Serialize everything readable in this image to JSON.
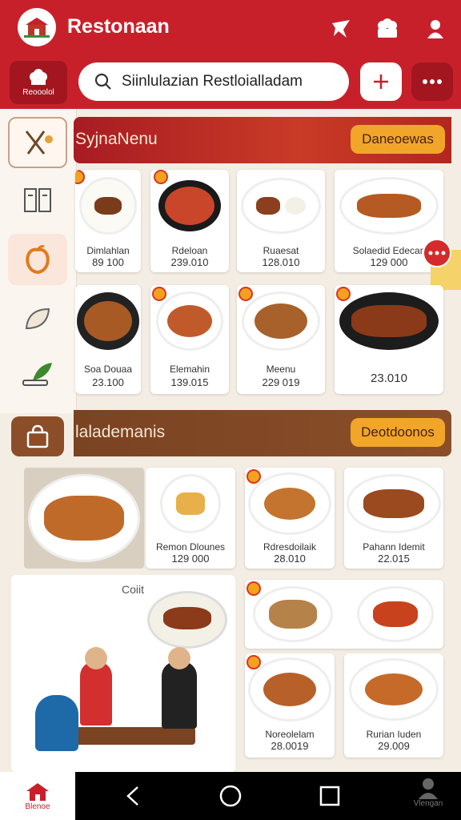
{
  "app": {
    "title": "Restonaan",
    "logo_icon": "restaurant-logo-icon"
  },
  "header": {
    "icons": [
      "pin-icon",
      "chef-hat-icon",
      "person-icon"
    ]
  },
  "searchbar": {
    "home_label": "Reooolol",
    "query": "Siinlulazian Restloialladam",
    "add_icon": "plus-icon",
    "more_icon": "more-dots-icon"
  },
  "sidebar": {
    "items": [
      {
        "icon": "utensils-icon",
        "selected": true
      },
      {
        "icon": "menu-card-icon",
        "selected": false
      },
      {
        "icon": "fruit-icon",
        "selected": true
      },
      {
        "icon": "leaf-icon",
        "selected": false
      },
      {
        "icon": "herb-icon",
        "selected": false
      }
    ]
  },
  "section1": {
    "title": "SyjnaNenu",
    "button": "Daneoewas",
    "items": [
      {
        "name": "Dimlahlan",
        "price": "89 100"
      },
      {
        "name": "Rdeloan",
        "price": "239.010"
      },
      {
        "name": "Ruaesat",
        "price": "128.010"
      },
      {
        "name": "Solaedid Edecan",
        "price": "129 000"
      },
      {
        "name": "Soa Douaa",
        "price": "23.100"
      },
      {
        "name": "Elemahin",
        "price": "139.015"
      },
      {
        "name": "Meenu",
        "price": "229 019"
      },
      {
        "name": "",
        "price": "23.010"
      }
    ]
  },
  "section2": {
    "title": "lalademanis",
    "button": "Deotdoonos",
    "cont_label": "Coiit",
    "items": [
      {
        "name": "Remon Dlounes",
        "price": "129 000"
      },
      {
        "name": "Rdresdoilaik",
        "price": "28.010"
      },
      {
        "name": "Pahann Idemit",
        "price": "22.015"
      },
      {
        "name": "Noreolelam",
        "price": "28.0019"
      },
      {
        "name": "Rurian Iuden",
        "price": "29.009"
      }
    ]
  },
  "bottom_nav": {
    "home_label": "Blenoe",
    "user_label": "Vlengan"
  },
  "colors": {
    "primary": "#c8202a",
    "accent": "#f1a62a",
    "brown": "#8b4e29"
  }
}
